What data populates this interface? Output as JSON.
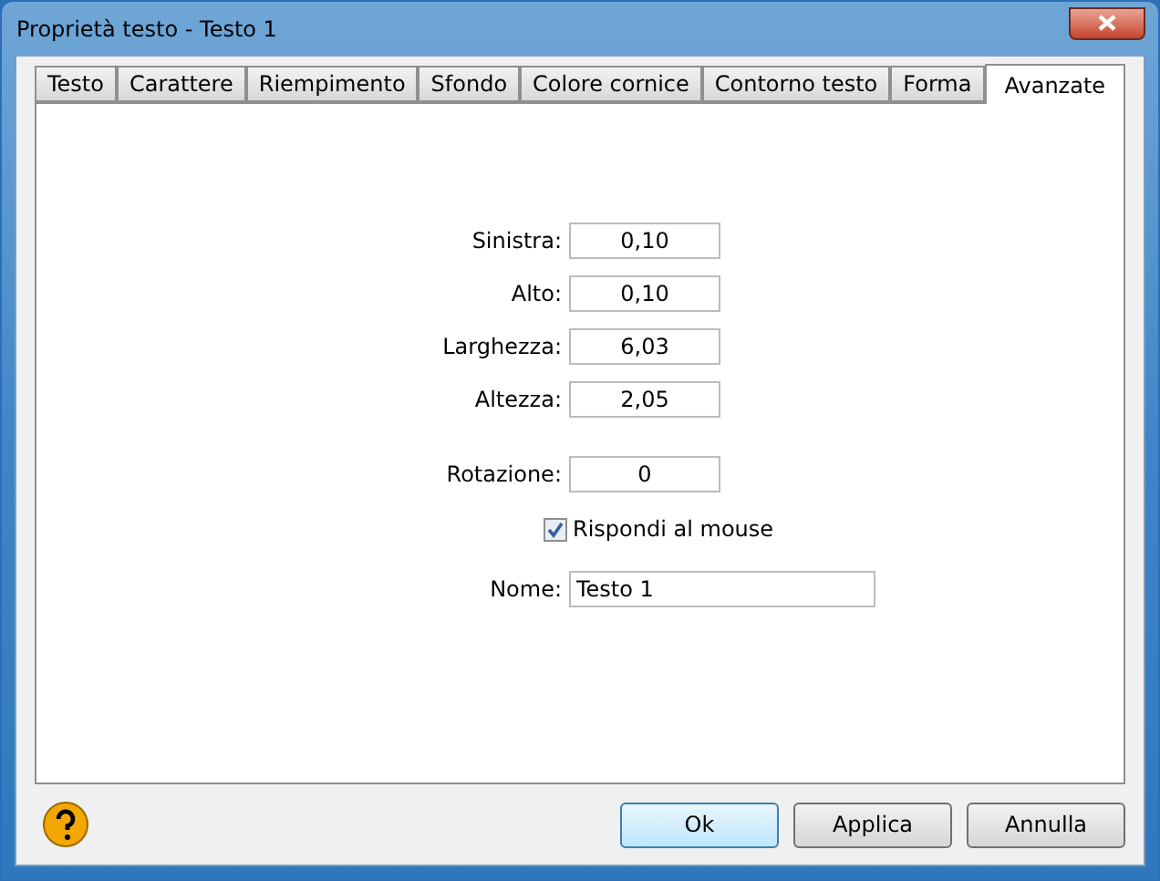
{
  "window": {
    "title": "Proprietà testo - Testo 1"
  },
  "tabs": [
    {
      "label": "Testo",
      "selected": false
    },
    {
      "label": "Carattere",
      "selected": false
    },
    {
      "label": "Riempimento",
      "selected": false
    },
    {
      "label": "Sfondo",
      "selected": false
    },
    {
      "label": "Colore cornice",
      "selected": false
    },
    {
      "label": "Contorno testo",
      "selected": false
    },
    {
      "label": "Forma",
      "selected": false
    },
    {
      "label": "Avanzate",
      "selected": true
    }
  ],
  "position_fields": [
    {
      "label": "Sinistra:",
      "value": "0,10"
    },
    {
      "label": "Alto:",
      "value": "0,10"
    },
    {
      "label": "Larghezza:",
      "value": "6,03"
    },
    {
      "label": "Altezza:",
      "value": "2,05"
    }
  ],
  "rotation_field": {
    "label": "Rotazione:",
    "value": "0"
  },
  "mouse_checkbox": {
    "label": "Rispondi al mouse",
    "checked": true
  },
  "name_field": {
    "label": "Nome:",
    "value": "Testo 1"
  },
  "buttons": [
    {
      "label": "Ok",
      "default": true
    },
    {
      "label": "Applica",
      "default": false
    },
    {
      "label": "Annulla",
      "default": false
    }
  ]
}
